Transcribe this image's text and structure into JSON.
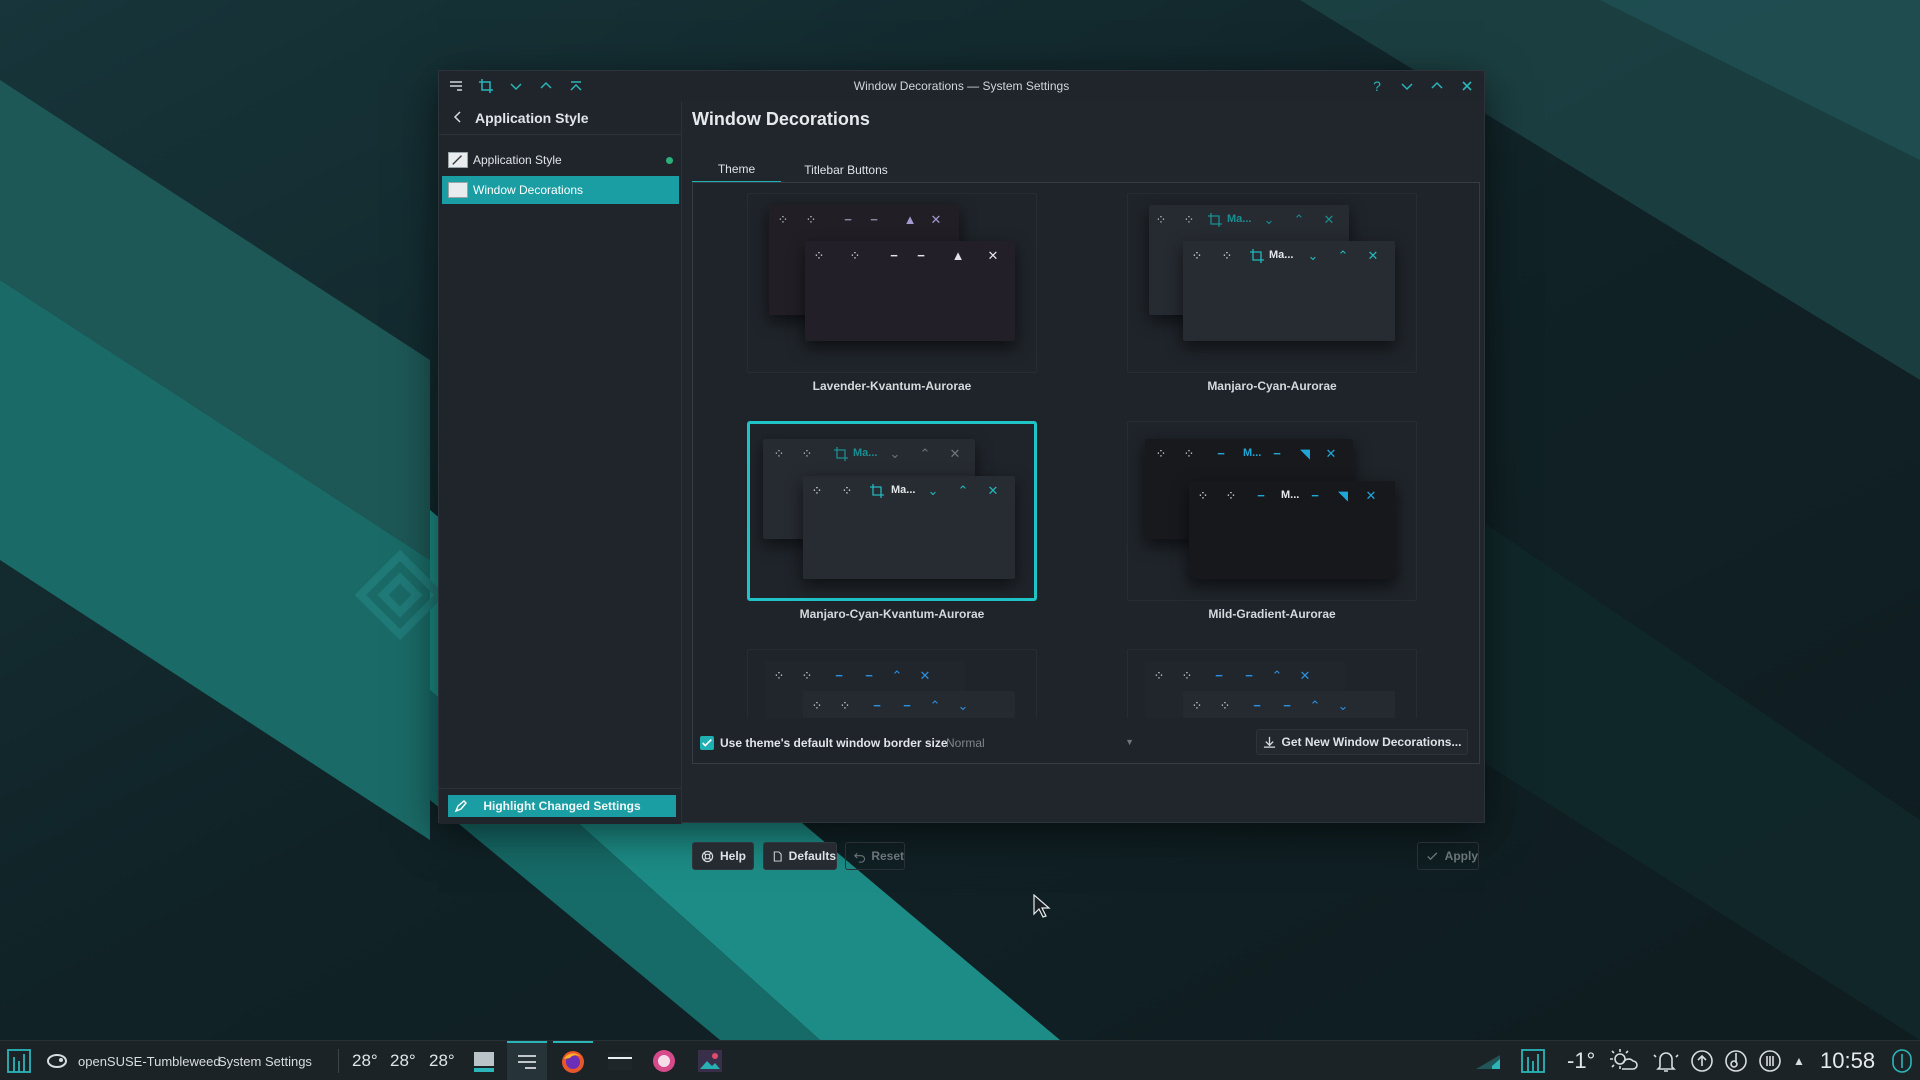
{
  "window": {
    "title": "Window Decorations — System Settings",
    "titlebar_left_icons": [
      "menu-icon",
      "crop-icon",
      "chevron-down-icon",
      "chevron-up-icon",
      "chevron-double-up-icon"
    ],
    "titlebar_right_icons": [
      "help-icon",
      "minimize-icon",
      "maximize-icon",
      "close-icon"
    ]
  },
  "sidebar": {
    "header": "Application Style",
    "items": [
      {
        "label": "Application Style",
        "changed": true
      },
      {
        "label": "Window Decorations",
        "active": true
      }
    ],
    "footer_button": "Highlight Changed Settings"
  },
  "main": {
    "title": "Window Decorations",
    "tabs": [
      {
        "label": "Theme",
        "active": true
      },
      {
        "label": "Titlebar Buttons",
        "active": false
      }
    ],
    "themes": [
      {
        "name": "Lavender-Kvantum-Aurorae",
        "selected": false,
        "preview_title": ""
      },
      {
        "name": "Manjaro-Cyan-Aurorae",
        "selected": false,
        "preview_title": "Ma..."
      },
      {
        "name": "Manjaro-Cyan-Kvantum-Aurorae",
        "selected": true,
        "preview_title": "Ma..."
      },
      {
        "name": "Mild-Gradient-Aurorae",
        "selected": false,
        "preview_title": "M..."
      },
      {
        "name": "",
        "selected": false,
        "preview_title": ""
      },
      {
        "name": "",
        "selected": false,
        "preview_title": ""
      }
    ],
    "border_checkbox_label": "Use theme's default window border size",
    "border_checkbox_checked": true,
    "border_size_value": "Normal",
    "get_new_button": "Get New Window Decorations..."
  },
  "dialog_buttons": {
    "help": "Help",
    "defaults": "Defaults",
    "reset": "Reset",
    "apply": "Apply"
  },
  "taskbar": {
    "distro": "openSUSE-Tumbleweed",
    "active_app": "System Settings",
    "temps": [
      "28°",
      "28°",
      "28°"
    ],
    "weather_temp": "-1°",
    "clock": "10:58"
  },
  "colors": {
    "accent": "#1fb1b5",
    "window_bg": "#21262d",
    "taskbar_bg": "#1c2327"
  }
}
